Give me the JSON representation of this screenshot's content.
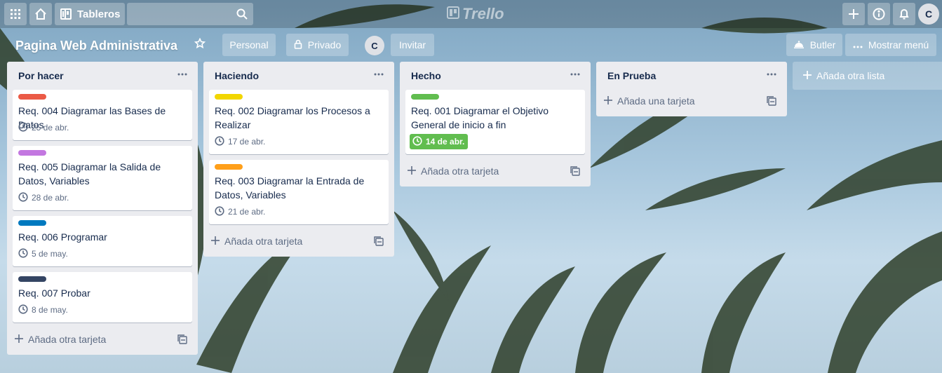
{
  "header": {
    "apps_icon": "grid-icon",
    "home_icon": "home-icon",
    "boards_label": "Tableros",
    "search_icon": "search-icon",
    "logo_text": "Trello",
    "add_icon": "plus-icon",
    "info_icon": "info-icon",
    "notifications_icon": "bell-icon",
    "user_initial": "C"
  },
  "board": {
    "title": "Pagina Web Administrativa",
    "visibility_team": "Personal",
    "visibility_privacy": "Privado",
    "member_initial": "C",
    "invite_label": "Invitar",
    "butler_label": "Butler",
    "show_menu_label": "Mostrar menú"
  },
  "lists": [
    {
      "title": "Por hacer",
      "add_card_label": "Añada otra tarjeta",
      "cards": [
        {
          "label_color": "#eb5a46",
          "title": "Req. 004 Diagramar las Bases de Datos",
          "due": "25 de abr."
        },
        {
          "label_color": "#c377e0",
          "title": "Req. 005 Diagramar la Salida de Datos, Variables",
          "due": "28 de abr."
        },
        {
          "label_color": "#0079bf",
          "title": "Req. 006 Programar",
          "due": "5 de may."
        },
        {
          "label_color": "#344563",
          "title": "Req. 007 Probar",
          "due": "8 de may."
        }
      ]
    },
    {
      "title": "Haciendo",
      "add_card_label": "Añada otra tarjeta",
      "cards": [
        {
          "label_color": "#f2d600",
          "title": "Req. 002 Diagramar los Procesos a Realizar",
          "due": "17 de abr."
        },
        {
          "label_color": "#ff9f1a",
          "title": "Req. 003 Diagramar la Entrada de Datos, Variables",
          "due": "21 de abr."
        }
      ]
    },
    {
      "title": "Hecho",
      "add_card_label": "Añada otra tarjeta",
      "cards": [
        {
          "label_color": "#61bd4f",
          "title": "Req. 001 Diagramar el Objetivo General de inicio a fin",
          "due": "14 de abr.",
          "due_complete": true
        }
      ]
    },
    {
      "title": "En Prueba",
      "add_card_label": "Añada una tarjeta",
      "cards": []
    }
  ],
  "add_list_label": "Añada otra lista",
  "colors": {
    "list_bg": "#ebecf0",
    "card_text": "#172b4d",
    "meta_text": "#5e6c84",
    "due_complete": "#61bd4f"
  }
}
